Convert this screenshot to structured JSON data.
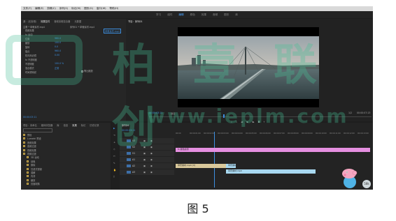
{
  "menu": [
    "文件(F)",
    "编辑(E)",
    "剪辑(C)",
    "序列(S)",
    "标记(M)",
    "图形(G)",
    "窗口(W)",
    "帮助(H)"
  ],
  "workspaces": [
    {
      "label": "学习",
      "active": false
    },
    {
      "label": "组件",
      "active": false
    },
    {
      "label": "编辑",
      "active": true
    },
    {
      "label": "颜色",
      "active": false
    },
    {
      "label": "效果",
      "active": false
    },
    {
      "label": "音频",
      "active": false
    },
    {
      "label": "图形",
      "active": false
    },
    {
      "label": "库",
      "active": false
    }
  ],
  "source_panel": {
    "tabs": [
      {
        "label": "源：(无剪辑)",
        "on": false
      },
      {
        "label": "效果控件",
        "on": true
      },
      {
        "label": "音频剪辑混合器",
        "on": false
      },
      {
        "label": "元数据",
        "on": false
      }
    ],
    "header": "主要 * 草菅素材.mp4",
    "seq": "序列01 * 草菅素材.mp4",
    "badge": "草菅素材.mp4",
    "rows": [
      {
        "label": "视频效果"
      },
      {
        "label": "fx 运动"
      },
      {
        "label": "位置",
        "value": "960.0"
      },
      {
        "label": "缩放",
        "value": "100.0"
      },
      {
        "label": "旋转",
        "value": "0.0"
      },
      {
        "label": "锚点",
        "value": "960.0"
      },
      {
        "label": "防闪烁滤镜",
        "value": "0.00"
      },
      {
        "label": "fx 不透明度"
      },
      {
        "label": "不透明度",
        "value": "100.0 %"
      },
      {
        "label": "混合模式",
        "value": "正常"
      },
      {
        "label": "时间重映射"
      }
    ],
    "equal_scale": "等比缩放",
    "time": "00:00:03:11"
  },
  "program_monitor": {
    "tabs": [
      {
        "label": "节目：序列01",
        "on": true
      }
    ],
    "time_left": "00:00:03:11",
    "fit": "适合",
    "ratio": "1/2",
    "time_right": "00:00:07:13"
  },
  "project_panel": {
    "tabs": [
      {
        "label": "项目：未命名",
        "on": false
      },
      {
        "label": "媒体浏览器",
        "on": false
      },
      {
        "label": "库",
        "on": false
      },
      {
        "label": "信息",
        "on": false
      },
      {
        "label": "效果",
        "on": true
      },
      {
        "label": "标记",
        "on": false
      },
      {
        "label": "历史记录",
        "on": false
      }
    ],
    "search_placeholder": "",
    "items": [
      "预设",
      "Lumetri 预设",
      "音频效果",
      "音频过渡",
      "视频效果",
      "视频过渡",
      "3D 运动",
      "划像",
      "擦除",
      "沉浸式视频",
      "溶解",
      "内滑",
      "缩放",
      "页面剥落"
    ]
  },
  "timeline": {
    "tabs": [
      {
        "label": "序列01",
        "on": true
      }
    ],
    "time": "00:00:03:11",
    "ruler": [
      "00:00",
      "00:00:01:00",
      "00:00:02:00",
      "00:00:03:00",
      "00:00:04:00",
      "00:00:05:00",
      "00:00:06:00",
      "00:00:07:00",
      "00:00:08:00",
      "00:00:09:00",
      "00:00:10:00",
      "00:00:11:00",
      "00:00:12:00",
      "00:00:13:00"
    ],
    "tracks": [
      "V3",
      "V2",
      "V1",
      "A1",
      "A2",
      "A3"
    ],
    "clips": {
      "pink": "fx 颜色遮罩",
      "v1a": "草菅素材.mp4 [V]",
      "v1b": "草菅素材.mp4",
      "a1": "草菅素材.mp4"
    }
  },
  "watermark": {
    "brand": "柏 壹 联 创",
    "url": "www.ieplm.com"
  },
  "caption": "图 5",
  "colors": {
    "accent": "#3d8fe0",
    "clip_pink": "#e58fe0",
    "clip_cyan": "#a8d8f0",
    "clip_tan": "#d9c89a"
  }
}
